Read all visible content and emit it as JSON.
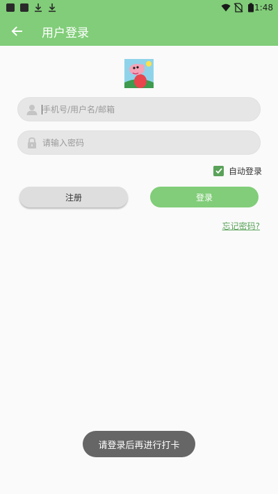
{
  "status_bar": {
    "time": "1:48",
    "icons": [
      "app-notification-icon",
      "app-notification-icon",
      "download-icon",
      "download-icon",
      "wifi-icon",
      "no-sim-icon",
      "battery-icon"
    ]
  },
  "app_bar": {
    "title": "用户登录",
    "back_icon": "arrow-left-icon",
    "color": "#81cd79"
  },
  "form": {
    "username": {
      "placeholder": "手机号/用户名/邮箱",
      "value": "",
      "icon": "user-icon"
    },
    "password": {
      "placeholder": "请输入密码",
      "value": "",
      "icon": "lock-icon"
    },
    "auto_login": {
      "label": "自动登录",
      "checked": true
    }
  },
  "buttons": {
    "register": "注册",
    "login": "登录"
  },
  "forgot_password": "忘记密码?",
  "toast": "请登录后再进行打卡",
  "colors": {
    "accent": "#81cd79",
    "checkbox": "#5aa25a",
    "link": "#5aa25a",
    "toast_bg": "#666666"
  }
}
